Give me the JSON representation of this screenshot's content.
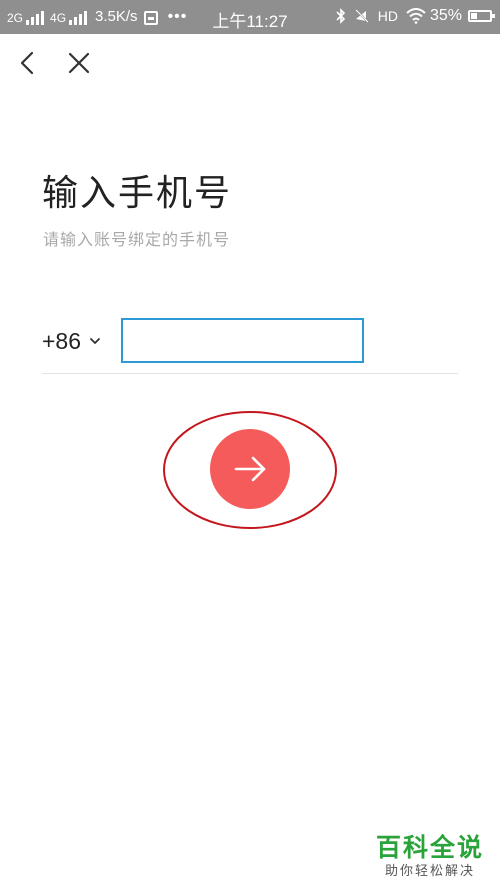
{
  "status_bar": {
    "net1": "2G",
    "net2": "4G",
    "speed": "3.5K/s",
    "dots": "•••",
    "time": "上午11:27",
    "hd": "HD",
    "battery": "35%",
    "icons": [
      "signal-icon",
      "sim-icon",
      "bluetooth-icon",
      "mute-icon",
      "wifi-icon",
      "battery-icon"
    ]
  },
  "nav": {
    "back_icon": "chevron-left-icon",
    "close_icon": "close-icon"
  },
  "page": {
    "title": "输入手机号",
    "subtitle": "请输入账号绑定的手机号"
  },
  "phone": {
    "country_code": "+86",
    "value": "",
    "placeholder": ""
  },
  "next_button": {
    "icon": "arrow-right-icon",
    "color": "#f55b5b"
  },
  "annotation": {
    "color": "#c4161c"
  },
  "watermark": {
    "main": "百科全说",
    "sub": "助你轻松解决"
  },
  "colors": {
    "accent_border": "#2d9ad6",
    "status_bar_bg": "#8f8f8f",
    "watermark_green": "#2aa33a"
  }
}
